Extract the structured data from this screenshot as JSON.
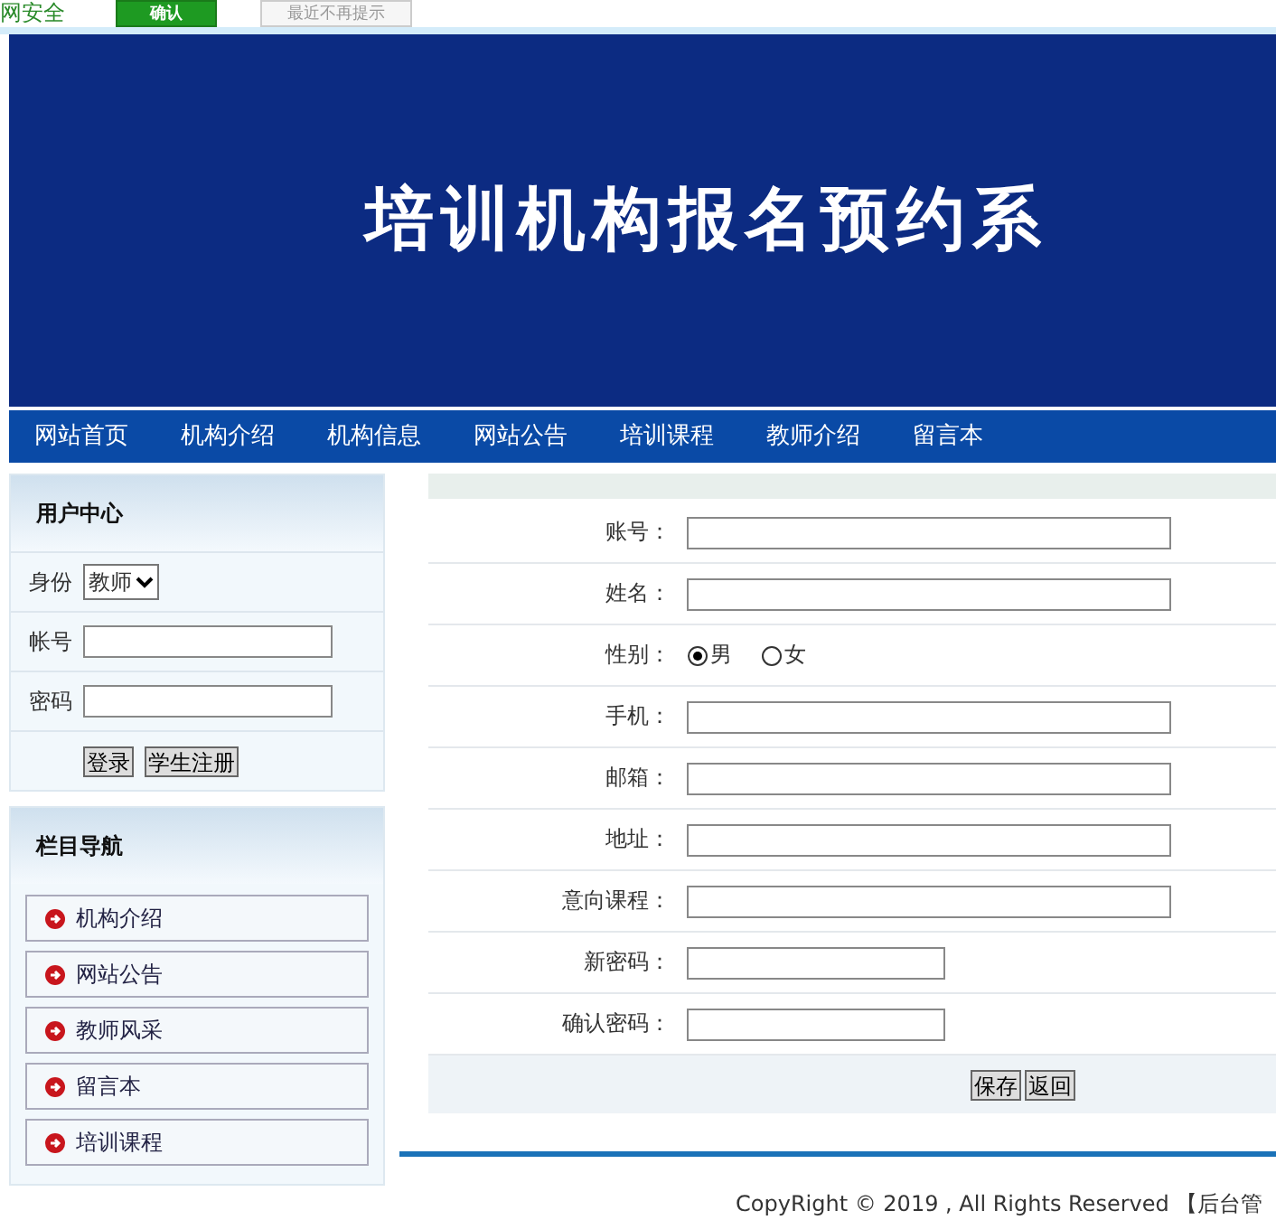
{
  "notice_bar": {
    "text": "网安全",
    "buttons": [
      {
        "label": "确认",
        "kind": "primary"
      },
      {
        "label": "最近不再提示",
        "kind": "plain"
      }
    ]
  },
  "banner": {
    "title": "培训机构报名预约系"
  },
  "nav": [
    "网站首页",
    "机构介绍",
    "机构信息",
    "网站公告",
    "培训课程",
    "教师介绍",
    "留言本"
  ],
  "user_center": {
    "title": "用户中心",
    "role_label": "身份",
    "role_value": "教师",
    "account_label": "帐号",
    "password_label": "密码",
    "buttons": [
      "登录",
      "学生注册"
    ]
  },
  "column_nav": {
    "title": "栏目导航",
    "items": [
      "机构介绍",
      "网站公告",
      "教师风采",
      "留言本",
      "培训课程"
    ]
  },
  "form": {
    "rows": [
      {
        "label": "账号：",
        "kind": "text"
      },
      {
        "label": "姓名：",
        "kind": "text"
      },
      {
        "label": "性别：",
        "kind": "radio",
        "options": [
          {
            "label": "男",
            "selected": true
          },
          {
            "label": "女",
            "selected": false
          }
        ]
      },
      {
        "label": "手机：",
        "kind": "text"
      },
      {
        "label": "邮箱：",
        "kind": "text"
      },
      {
        "label": "地址：",
        "kind": "text"
      },
      {
        "label": "意向课程：",
        "kind": "text"
      },
      {
        "label": "新密码：",
        "kind": "password"
      },
      {
        "label": "确认密码：",
        "kind": "password"
      }
    ],
    "buttons": [
      "保存",
      "返回"
    ]
  },
  "footer": {
    "text": "CopyRight © 2019 , All Rights Reserved 【后台管"
  }
}
